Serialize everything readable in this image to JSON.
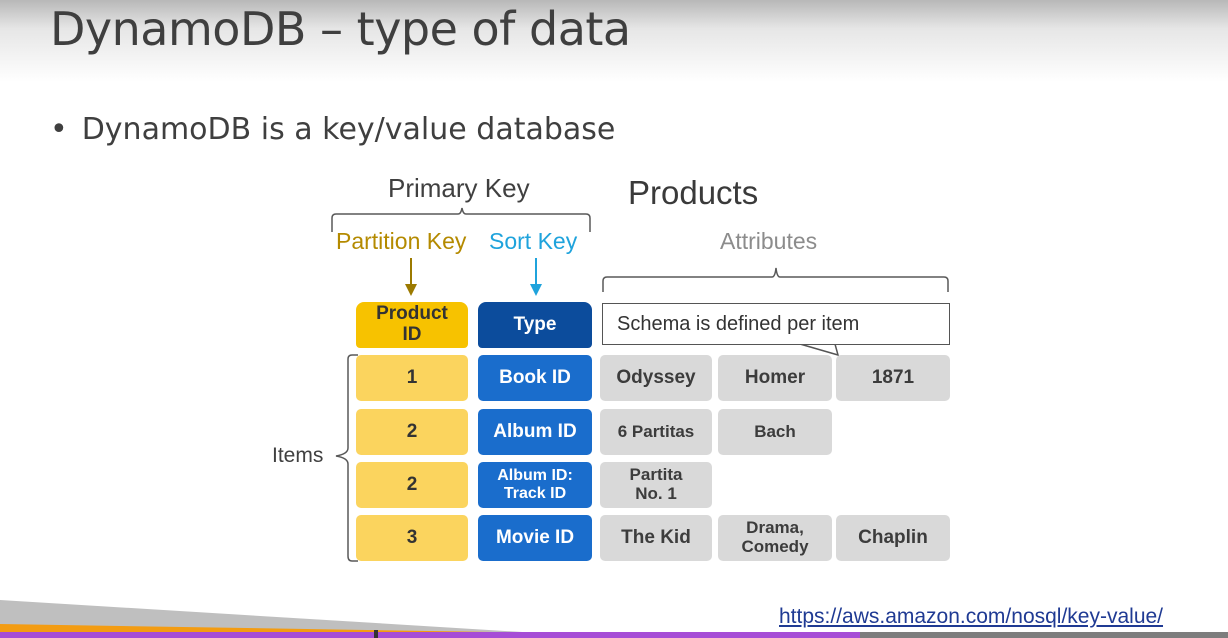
{
  "slide": {
    "title": "DynamoDB – type of data",
    "bullet": "DynamoDB is a key/value database"
  },
  "diagram": {
    "primary_key_label": "Primary Key",
    "table_name": "Products",
    "partition_key_label": "Partition Key",
    "sort_key_label": "Sort Key",
    "attributes_label": "Attributes",
    "items_label": "Items",
    "schema_callout": "Schema is defined per item",
    "headers": {
      "product_id": "Product ID",
      "type": "Type"
    },
    "rows": [
      {
        "product_id": "1",
        "type": "Book ID",
        "attributes": [
          "Odyssey",
          "Homer",
          "1871"
        ]
      },
      {
        "product_id": "2",
        "type": "Album ID",
        "attributes": [
          "6 Partitas",
          "Bach"
        ]
      },
      {
        "product_id": "2",
        "type": "Album ID: Track ID",
        "attributes": [
          "Partita No. 1"
        ]
      },
      {
        "product_id": "3",
        "type": "Movie ID",
        "attributes": [
          "The Kid",
          "Drama, Comedy",
          "Chaplin"
        ]
      }
    ],
    "colors": {
      "partition_key": "#f7c200",
      "partition_cell": "#fbd45e",
      "sort_key_label": "#1fa3dc",
      "type_header": "#0c4c9c",
      "type_cell": "#1a6dcc",
      "attribute_cell": "#d9d9d9"
    }
  },
  "footer": {
    "link_text": "https://aws.amazon.com/nosql/key-value/"
  }
}
